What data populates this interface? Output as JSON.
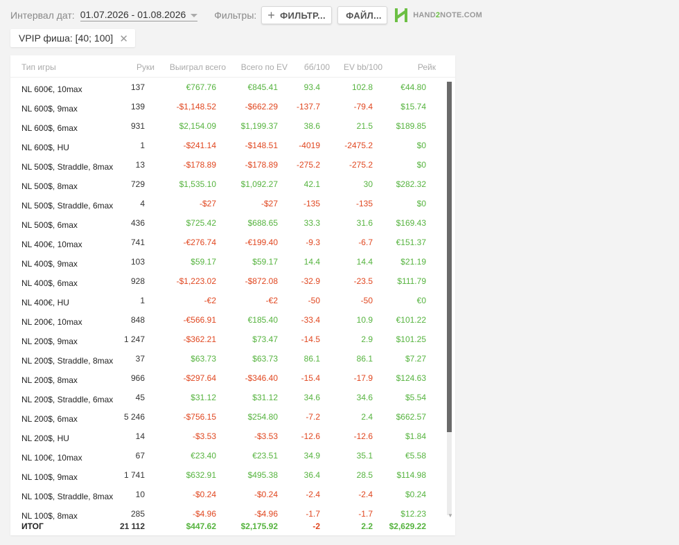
{
  "toolbar": {
    "date_label": "Интервал дат:",
    "date_range": "01.07.2026 - 01.08.2026",
    "filters_label": "Фильтры:",
    "filter_button": "ФИЛЬТР...",
    "file_button": "ФАЙЛ...",
    "logo_text_a": "HAND",
    "logo_text_b": "2",
    "logo_text_c": "NOTE.COM"
  },
  "chip": {
    "label": "VPIP фиша: [40; 100]"
  },
  "table": {
    "headers": {
      "game": "Тип игры",
      "hands": "Руки",
      "won": "Выиграл всего",
      "ev": "Всего по EV",
      "bb100": "бб/100",
      "evbb": "EV bb/100",
      "rake": "Рейк"
    },
    "rows": [
      {
        "game": "NL 600€, 10max",
        "hands": "137",
        "won": "€767.76",
        "ev": "€845.41",
        "bb100": "93.4",
        "evbb": "102.8",
        "rake": "€44.80"
      },
      {
        "game": "NL 600$, 9max",
        "hands": "139",
        "won": "-$1,148.52",
        "ev": "-$662.29",
        "bb100": "-137.7",
        "evbb": "-79.4",
        "rake": "$15.74"
      },
      {
        "game": "NL 600$, 6max",
        "hands": "931",
        "won": "$2,154.09",
        "ev": "$1,199.37",
        "bb100": "38.6",
        "evbb": "21.5",
        "rake": "$189.85"
      },
      {
        "game": "NL 600$, HU",
        "hands": "1",
        "won": "-$241.14",
        "ev": "-$148.51",
        "bb100": "-4019",
        "evbb": "-2475.2",
        "rake": "$0"
      },
      {
        "game": "NL 500$, Straddle, 8max",
        "hands": "13",
        "won": "-$178.89",
        "ev": "-$178.89",
        "bb100": "-275.2",
        "evbb": "-275.2",
        "rake": "$0"
      },
      {
        "game": "NL 500$, 8max",
        "hands": "729",
        "won": "$1,535.10",
        "ev": "$1,092.27",
        "bb100": "42.1",
        "evbb": "30",
        "rake": "$282.32"
      },
      {
        "game": "NL 500$, Straddle, 6max",
        "hands": "4",
        "won": "-$27",
        "ev": "-$27",
        "bb100": "-135",
        "evbb": "-135",
        "rake": "$0"
      },
      {
        "game": "NL 500$, 6max",
        "hands": "436",
        "won": "$725.42",
        "ev": "$688.65",
        "bb100": "33.3",
        "evbb": "31.6",
        "rake": "$169.43"
      },
      {
        "game": "NL 400€, 10max",
        "hands": "741",
        "won": "-€276.74",
        "ev": "-€199.40",
        "bb100": "-9.3",
        "evbb": "-6.7",
        "rake": "€151.37"
      },
      {
        "game": "NL 400$, 9max",
        "hands": "103",
        "won": "$59.17",
        "ev": "$59.17",
        "bb100": "14.4",
        "evbb": "14.4",
        "rake": "$21.19"
      },
      {
        "game": "NL 400$, 6max",
        "hands": "928",
        "won": "-$1,223.02",
        "ev": "-$872.08",
        "bb100": "-32.9",
        "evbb": "-23.5",
        "rake": "$111.79"
      },
      {
        "game": "NL 400€, HU",
        "hands": "1",
        "won": "-€2",
        "ev": "-€2",
        "bb100": "-50",
        "evbb": "-50",
        "rake": "€0"
      },
      {
        "game": "NL 200€, 10max",
        "hands": "848",
        "won": "-€566.91",
        "ev": "€185.40",
        "bb100": "-33.4",
        "evbb": "10.9",
        "rake": "€101.22"
      },
      {
        "game": "NL 200$, 9max",
        "hands": "1 247",
        "won": "-$362.21",
        "ev": "$73.47",
        "bb100": "-14.5",
        "evbb": "2.9",
        "rake": "$101.25"
      },
      {
        "game": "NL 200$, Straddle, 8max",
        "hands": "37",
        "won": "$63.73",
        "ev": "$63.73",
        "bb100": "86.1",
        "evbb": "86.1",
        "rake": "$7.27"
      },
      {
        "game": "NL 200$, 8max",
        "hands": "966",
        "won": "-$297.64",
        "ev": "-$346.40",
        "bb100": "-15.4",
        "evbb": "-17.9",
        "rake": "$124.63"
      },
      {
        "game": "NL 200$, Straddle, 6max",
        "hands": "45",
        "won": "$31.12",
        "ev": "$31.12",
        "bb100": "34.6",
        "evbb": "34.6",
        "rake": "$5.54"
      },
      {
        "game": "NL 200$, 6max",
        "hands": "5 246",
        "won": "-$756.15",
        "ev": "$254.80",
        "bb100": "-7.2",
        "evbb": "2.4",
        "rake": "$662.57"
      },
      {
        "game": "NL 200$, HU",
        "hands": "14",
        "won": "-$3.53",
        "ev": "-$3.53",
        "bb100": "-12.6",
        "evbb": "-12.6",
        "rake": "$1.84"
      },
      {
        "game": "NL 100€, 10max",
        "hands": "67",
        "won": "€23.40",
        "ev": "€23.51",
        "bb100": "34.9",
        "evbb": "35.1",
        "rake": "€5.58"
      },
      {
        "game": "NL 100$, 9max",
        "hands": "1 741",
        "won": "$632.91",
        "ev": "$495.38",
        "bb100": "36.4",
        "evbb": "28.5",
        "rake": "$114.98"
      },
      {
        "game": "NL 100$, Straddle, 8max",
        "hands": "10",
        "won": "-$0.24",
        "ev": "-$0.24",
        "bb100": "-2.4",
        "evbb": "-2.4",
        "rake": "$0.24"
      },
      {
        "game": "NL 100$, 8max",
        "hands": "285",
        "won": "-$4.96",
        "ev": "-$4.96",
        "bb100": "-1.7",
        "evbb": "-1.7",
        "rake": "$12.23"
      }
    ],
    "total": {
      "game": "ИТОГ",
      "hands": "21 112",
      "won": "$447.62",
      "ev": "$2,175.92",
      "bb100": "-2",
      "evbb": "2.2",
      "rake": "$2,629.22"
    }
  },
  "colors": {
    "positive": "#55b33e",
    "negative": "#e0461f",
    "brand": "#6cbf44"
  },
  "icons": {
    "add": "plus-icon",
    "close": "close-icon",
    "dropdown": "chevron-down-icon",
    "logo": "hand2note-logo-icon"
  }
}
